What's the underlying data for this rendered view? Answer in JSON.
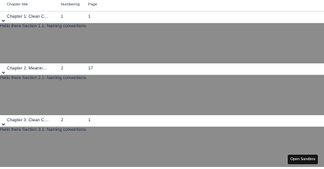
{
  "table": {
    "columns": {
      "title": "Chapter title",
      "numbering": "Numbering",
      "page": "Page"
    },
    "rows": [
      {
        "title": "Chapter 1: Clean Code",
        "numbering": "1",
        "page": "1",
        "expanded": true,
        "detail": "Hello there Section 1.1: Naming conventions"
      },
      {
        "title": "Chapter 2: Meaningful ...",
        "numbering": "2",
        "page": "17",
        "expanded": true,
        "detail": "Hello there Section 2.1: Naming conventions"
      },
      {
        "title": "Chapter 3: Clean Code",
        "numbering": "2",
        "page": "1",
        "expanded": true,
        "detail": "Hello there Section 3.1: Naming conventions"
      }
    ]
  },
  "colors": {
    "detail_background": "#8c8c8c",
    "text": "#1f2a44",
    "button_background": "#151515"
  },
  "icons": {
    "row_toggle": "chevron-down-icon"
  },
  "sandbox_button": {
    "label": "Open Sandbox"
  }
}
